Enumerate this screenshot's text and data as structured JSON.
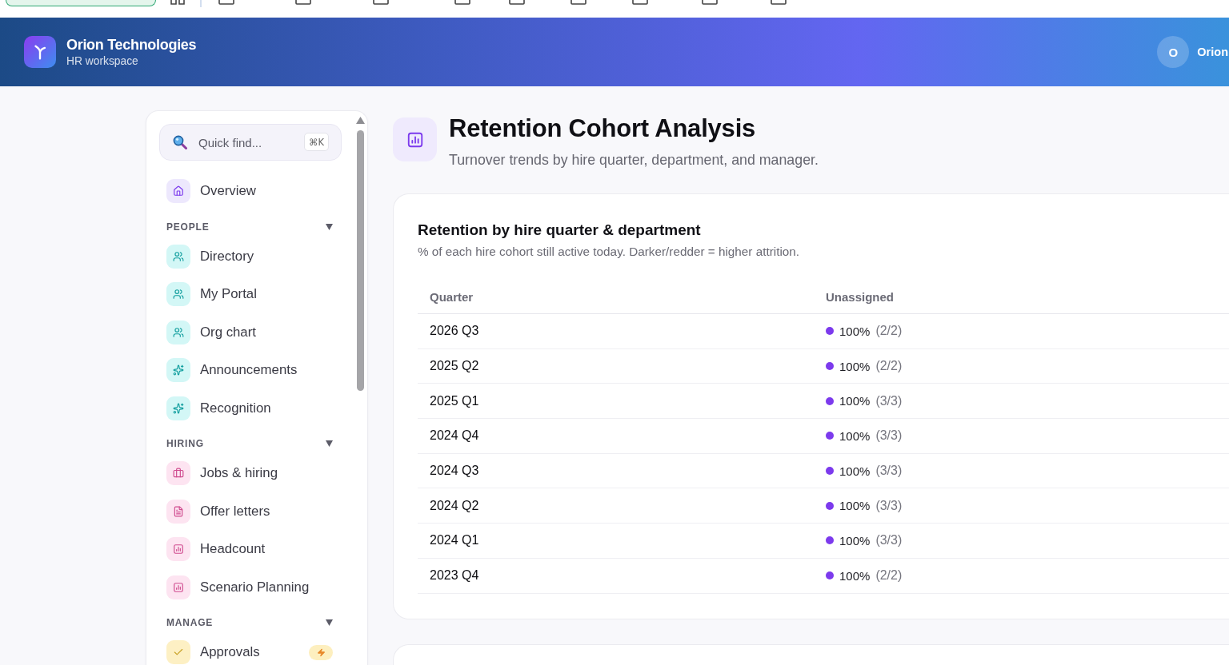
{
  "header": {
    "org_name": "Orion Technologies",
    "workspace": "HR workspace",
    "user": {
      "initial": "O",
      "name": "Orion"
    }
  },
  "sidebar": {
    "search": {
      "placeholder": "Quick find...",
      "shortcut": "⌘K"
    },
    "top_items": [
      {
        "label": "Overview",
        "selected": false,
        "alert": false
      }
    ],
    "sections": [
      {
        "title": "PEOPLE",
        "expanded": true,
        "items": [
          {
            "label": "Directory",
            "selected": false,
            "alert": false
          },
          {
            "label": "My Portal",
            "selected": false,
            "alert": false
          },
          {
            "label": "Org chart",
            "selected": false,
            "alert": false
          },
          {
            "label": "Announcements",
            "selected": false,
            "alert": false
          },
          {
            "label": "Recognition",
            "selected": false,
            "alert": false
          }
        ]
      },
      {
        "title": "HIRING",
        "expanded": true,
        "items": [
          {
            "label": "Jobs & hiring",
            "selected": false,
            "alert": false
          },
          {
            "label": "Offer letters",
            "selected": false,
            "alert": false
          },
          {
            "label": "Headcount",
            "selected": false,
            "alert": false
          },
          {
            "label": "Scenario Planning",
            "selected": false,
            "alert": false
          }
        ]
      },
      {
        "title": "MANAGE",
        "expanded": true,
        "items": [
          {
            "label": "Approvals",
            "selected": false,
            "alert": true
          }
        ]
      }
    ]
  },
  "page": {
    "title": "Retention Cohort Analysis",
    "subtitle": "Turnover trends by hire quarter, department, and manager."
  },
  "cohort_card": {
    "title": "Retention by hire quarter & department",
    "description": "% of each hire cohort still active today. Darker/redder = higher attrition.",
    "table": {
      "columns": [
        "Quarter",
        "Unassigned"
      ],
      "rows": [
        {
          "quarter": "2026 Q3",
          "unassigned": {
            "percent": "100%",
            "count": "(2/2)",
            "color": "#7c3aed"
          }
        },
        {
          "quarter": "2025 Q2",
          "unassigned": {
            "percent": "100%",
            "count": "(2/2)",
            "color": "#7c3aed"
          }
        },
        {
          "quarter": "2025 Q1",
          "unassigned": {
            "percent": "100%",
            "count": "(3/3)",
            "color": "#7c3aed"
          }
        },
        {
          "quarter": "2024 Q4",
          "unassigned": {
            "percent": "100%",
            "count": "(3/3)",
            "color": "#7c3aed"
          }
        },
        {
          "quarter": "2024 Q3",
          "unassigned": {
            "percent": "100%",
            "count": "(3/3)",
            "color": "#7c3aed"
          }
        },
        {
          "quarter": "2024 Q2",
          "unassigned": {
            "percent": "100%",
            "count": "(3/3)",
            "color": "#7c3aed"
          }
        },
        {
          "quarter": "2024 Q1",
          "unassigned": {
            "percent": "100%",
            "count": "(3/3)",
            "color": "#7c3aed"
          }
        },
        {
          "quarter": "2023 Q4",
          "unassigned": {
            "percent": "100%",
            "count": "(2/2)",
            "color": "#7c3aed"
          }
        }
      ]
    }
  }
}
